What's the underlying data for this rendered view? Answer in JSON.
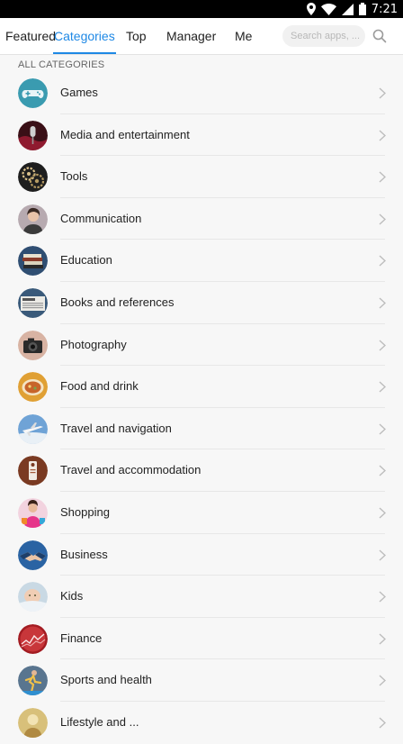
{
  "status_bar": {
    "time": "7:21",
    "icons": [
      "location-icon",
      "wifi-icon",
      "signal-icon",
      "battery-icon"
    ]
  },
  "nav": {
    "tabs": [
      {
        "label": "Featured",
        "active": false
      },
      {
        "label": "Categories",
        "active": true
      },
      {
        "label": "Top",
        "active": false
      },
      {
        "label": "Manager",
        "active": false
      },
      {
        "label": "Me",
        "active": false
      }
    ],
    "search_placeholder": "Search apps, ...",
    "accent_color": "#1e88e5"
  },
  "section": {
    "title": "ALL CATEGORIES"
  },
  "categories": [
    {
      "label": "Games",
      "icon": "gamepad-icon",
      "color": "#3a9bb0"
    },
    {
      "label": "Media and entertainment",
      "icon": "microphone-icon",
      "color": "#6b1d2a"
    },
    {
      "label": "Tools",
      "icon": "gears-icon",
      "color": "#2b2b2b"
    },
    {
      "label": "Communication",
      "icon": "phone-user-icon",
      "color": "#8f7f86"
    },
    {
      "label": "Education",
      "icon": "books-icon",
      "color": "#34506f"
    },
    {
      "label": "Books and references",
      "icon": "newspaper-icon",
      "color": "#3a5a7a"
    },
    {
      "label": "Photography",
      "icon": "camera-icon",
      "color": "#c69a8a"
    },
    {
      "label": "Food and drink",
      "icon": "food-bowl-icon",
      "color": "#d58a2a"
    },
    {
      "label": "Travel and navigation",
      "icon": "airplane-icon",
      "color": "#3d78b5"
    },
    {
      "label": "Travel and accommodation",
      "icon": "door-hanger-icon",
      "color": "#8a4025"
    },
    {
      "label": "Shopping",
      "icon": "shopper-icon",
      "color": "#d8448a"
    },
    {
      "label": "Business",
      "icon": "handshake-icon",
      "color": "#2b66a6"
    },
    {
      "label": "Kids",
      "icon": "baby-icon",
      "color": "#9fb6c7"
    },
    {
      "label": "Finance",
      "icon": "chart-icon",
      "color": "#a91f24"
    },
    {
      "label": "Sports and health",
      "icon": "runner-icon",
      "color": "#4c6a86"
    },
    {
      "label": "Lifestyle and ...",
      "icon": "lifestyle-icon",
      "color": "#d2b46a"
    }
  ]
}
